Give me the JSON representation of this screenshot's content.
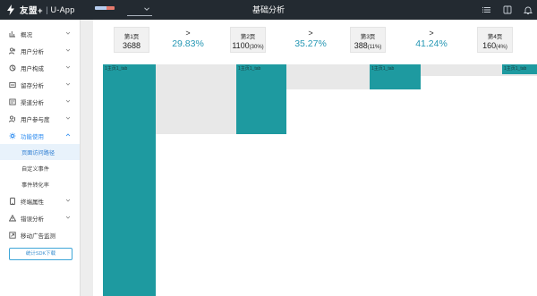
{
  "topbar": {
    "brand": "友盟+",
    "app": "U-App",
    "title": "基础分析"
  },
  "sidebar": {
    "items": [
      {
        "label": "概况",
        "icon": "overview-icon"
      },
      {
        "label": "用户分析",
        "icon": "user-analysis-icon"
      },
      {
        "label": "用户构成",
        "icon": "user-composition-icon"
      },
      {
        "label": "留存分析",
        "icon": "retention-icon"
      },
      {
        "label": "渠道分析",
        "icon": "channel-icon"
      },
      {
        "label": "用户参与度",
        "icon": "engagement-icon"
      },
      {
        "label": "功能使用",
        "icon": "feature-usage-icon"
      }
    ],
    "sub_items": [
      "页面访问路径",
      "自定义事件",
      "事件转化率"
    ],
    "items2": [
      {
        "label": "终端属性",
        "icon": "device-icon"
      },
      {
        "label": "错误分析",
        "icon": "error-icon"
      },
      {
        "label": "移动广告监测",
        "icon": "ad-monitor-icon"
      }
    ],
    "sdk_button": "统计SDK下载"
  },
  "steps": [
    {
      "label": "第1页",
      "value": "3688",
      "pct": ""
    },
    {
      "label": "第2页",
      "value": "1100",
      "pct": "(30%)"
    },
    {
      "label": "第3页",
      "value": "388",
      "pct": "(11%)"
    },
    {
      "label": "第4页",
      "value": "160",
      "pct": "(4%)"
    }
  ],
  "arrows": [
    {
      "symbol": ">",
      "rate": "29.83%"
    },
    {
      "symbol": ">",
      "rate": "35.27%"
    },
    {
      "symbol": ">",
      "rate": "41.24%"
    }
  ],
  "flow_labels": [
    "1主页1_tab",
    "1主页1_tab",
    "1主页1_tab",
    "1主页1_tab"
  ],
  "colors": {
    "accent": "#1e9aa0",
    "topbar": "#232a31",
    "rate": "#2597b4"
  }
}
